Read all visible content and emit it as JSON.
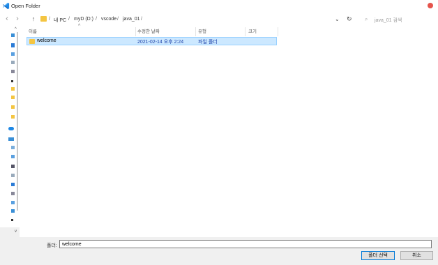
{
  "window": {
    "title": "Open Folder"
  },
  "nav": {
    "back_icon": "back-arrow-icon",
    "forward_icon": "forward-arrow-icon",
    "up_icon": "up-arrow-icon",
    "breadcrumb": [
      "내 PC",
      "myD (D:)",
      "vscode",
      "java_01"
    ],
    "separator": "/",
    "search_placeholder": "java_01 검색"
  },
  "columns": {
    "name": "이름",
    "modified": "수정한 날짜",
    "type": "유형",
    "size": "크기"
  },
  "rows": [
    {
      "name": "welcome",
      "modified": "2021-02-14 오후 2:24",
      "type": "파일 폴더",
      "size": ""
    }
  ],
  "footer": {
    "folder_label": "폴더:",
    "folder_value": "welcome",
    "select_label": "폴더 선택",
    "cancel_label": "취소"
  },
  "colors": {
    "accent": "#0078d7",
    "selection": "#cce8ff",
    "folder": "#f4c542",
    "close": "#e5534b"
  }
}
